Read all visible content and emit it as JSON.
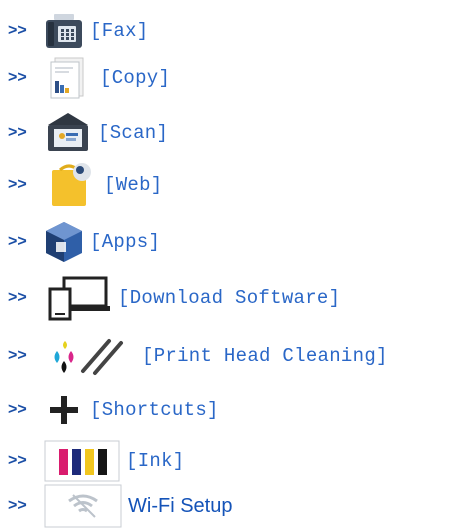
{
  "menu": {
    "prefix": ">>",
    "items": [
      {
        "label": "[Fax]",
        "icon": "fax-icon"
      },
      {
        "label": "[Copy]",
        "icon": "copy-icon"
      },
      {
        "label": "[Scan]",
        "icon": "scan-icon"
      },
      {
        "label": "[Web]",
        "icon": "web-icon"
      },
      {
        "label": "[Apps]",
        "icon": "apps-icon"
      },
      {
        "label": "[Download Software]",
        "icon": "download-software-icon"
      },
      {
        "label": "[Print Head Cleaning]",
        "icon": "print-head-cleaning-icon"
      },
      {
        "label": "[Shortcuts]",
        "icon": "plus-icon"
      },
      {
        "label": "[Ink]",
        "icon": "ink-icon"
      },
      {
        "label": "Wi-Fi Setup",
        "icon": "wifi-icon"
      }
    ]
  },
  "colors": {
    "prefix": "#1b4fa6",
    "label": "#2a67c7",
    "wifi_label": "#1453b8"
  }
}
